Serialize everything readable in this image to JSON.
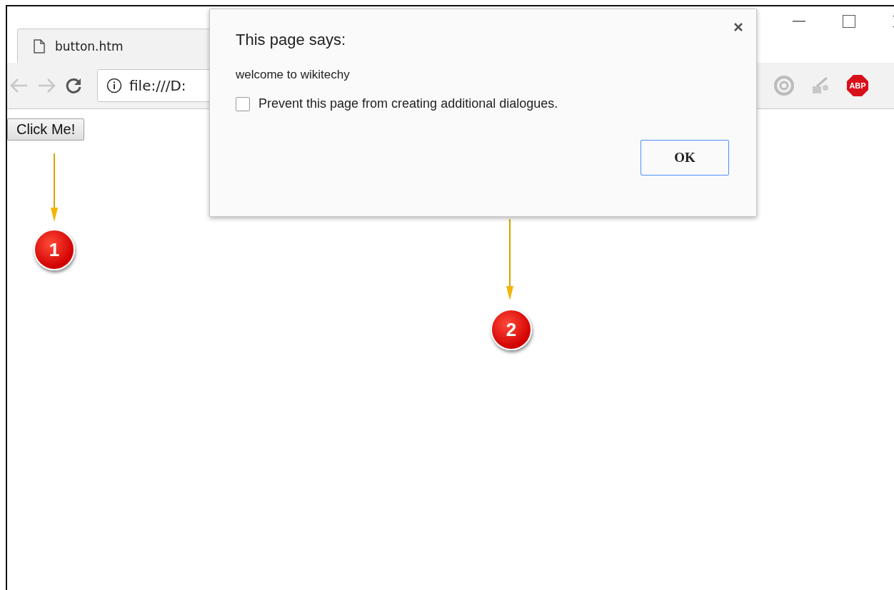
{
  "browser": {
    "tab": {
      "title": "button.htm"
    },
    "address_bar": {
      "value": "file:///D:"
    },
    "extensions": [
      {
        "kind": "circle"
      },
      {
        "kind": "figure"
      },
      {
        "kind": "stop",
        "label": "ABP"
      }
    ]
  },
  "page": {
    "button": {
      "label": "Click Me!"
    }
  },
  "dialog": {
    "title": "This page says:",
    "message": "welcome to wikitechy",
    "checkbox": {
      "label": "Prevent this page from creating additional dialogues.",
      "checked": false
    },
    "ok_button": {
      "label": "OK"
    }
  },
  "annotations": [
    {
      "number": "1"
    },
    {
      "number": "2"
    }
  ]
}
